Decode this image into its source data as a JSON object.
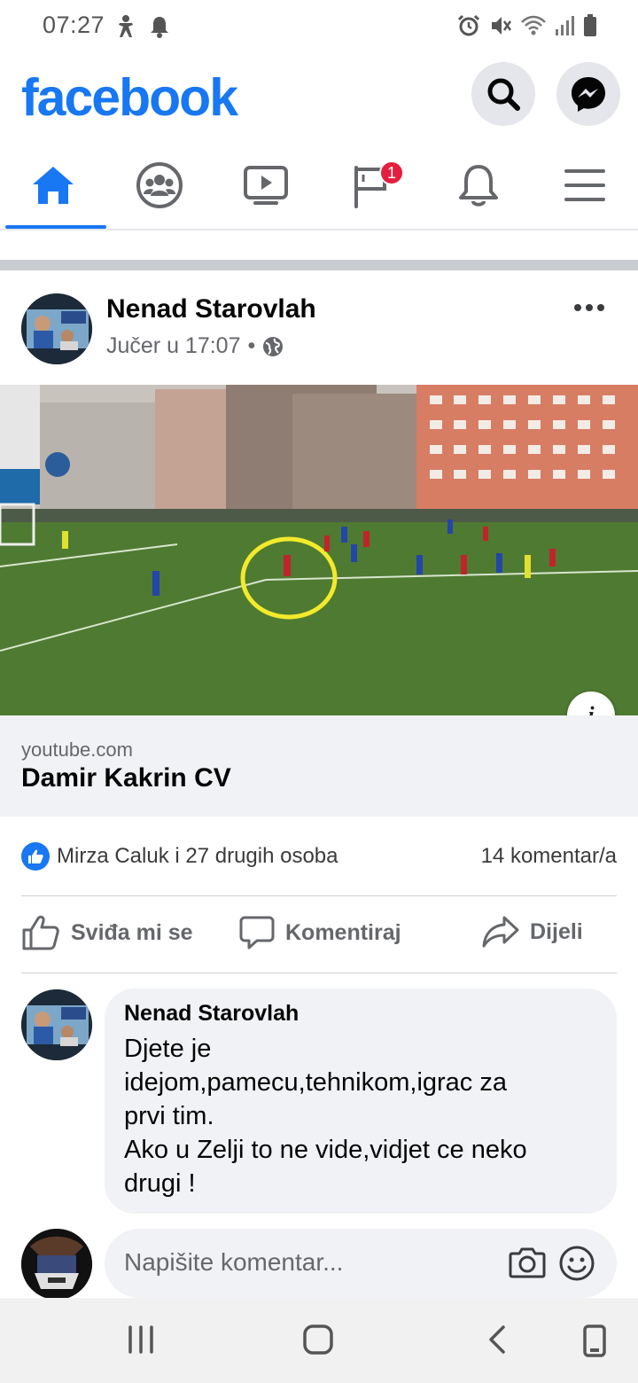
{
  "status_bar": {
    "time": "07:27",
    "left_icons": [
      "accessibility-icon",
      "notification-bell-icon"
    ],
    "right_icons": [
      "alarm-icon",
      "mute-icon",
      "wifi-icon",
      "signal-icon",
      "battery-icon"
    ]
  },
  "header": {
    "logo": "facebook",
    "brand_color": "#1877f2"
  },
  "tabs": [
    {
      "name": "home",
      "icon": "home-icon",
      "active": true
    },
    {
      "name": "groups",
      "icon": "groups-icon",
      "active": false
    },
    {
      "name": "watch",
      "icon": "video-icon",
      "active": false
    },
    {
      "name": "pages",
      "icon": "flag-icon",
      "badge": "1",
      "active": false
    },
    {
      "name": "notifications",
      "icon": "bell-icon",
      "active": false
    },
    {
      "name": "menu",
      "icon": "menu-icon",
      "active": false
    }
  ],
  "post": {
    "author": "Nenad Starovlah",
    "timestamp": "Jučer u 17:07",
    "separator": "•",
    "privacy_icon": "globe-icon",
    "link": {
      "domain": "youtube.com",
      "title": "Damir Kakrin CV"
    },
    "reactions_text": "Mirza Caluk i 27 drugih osoba",
    "comments_count": "14 komentar/a",
    "actions": {
      "like": "Sviđa mi se",
      "comment": "Komentiraj",
      "share": "Dijeli"
    }
  },
  "comment": {
    "author": "Nenad Starovlah",
    "text": "Djete je\nidejom,pamecu,tehnikom,igrac za\nprvi tim.\nAko u Zelji to ne vide,vidjet ce neko\ndrugi !"
  },
  "composer": {
    "placeholder": "Napišite komentar..."
  },
  "nav": [
    "recents-icon",
    "home-circle-icon",
    "back-icon",
    "rotate-icon"
  ]
}
